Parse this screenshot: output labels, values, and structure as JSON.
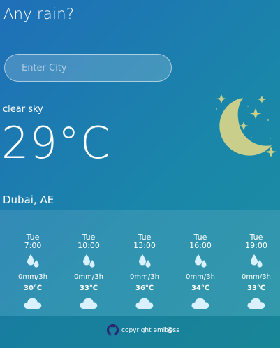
{
  "app": {
    "title": "Any rain?"
  },
  "search": {
    "placeholder": "Enter City"
  },
  "current": {
    "condition": "clear sky",
    "temperature": "29°C",
    "location": "Dubai, AE",
    "icon": "crescent-moon-with-stars-icon"
  },
  "forecast": [
    {
      "day": "Tue",
      "time": "7:00",
      "rain": "0mm/3h",
      "temp": "30℃",
      "icon": "cloud-icon"
    },
    {
      "day": "Tue",
      "time": "10:00",
      "rain": "0mm/3h",
      "temp": "33℃",
      "icon": "cloud-icon"
    },
    {
      "day": "Tue",
      "time": "13:00",
      "rain": "0mm/3h",
      "temp": "36℃",
      "icon": "cloud-icon"
    },
    {
      "day": "Tue",
      "time": "16:00",
      "rain": "0mm/3h",
      "temp": "34℃",
      "icon": "cloud-icon"
    },
    {
      "day": "Tue",
      "time": "19:00",
      "rain": "0mm/3h",
      "temp": "33℃",
      "icon": "cloud-icon"
    }
  ],
  "footer": {
    "text": "copyright emibass",
    "symbol": "©",
    "icon": "github-icon"
  },
  "colors": {
    "background_start": "#1f6fb8",
    "background_end": "#1b8fa1",
    "moon": "#c9cf8a",
    "drop": "#d9f1ff"
  }
}
